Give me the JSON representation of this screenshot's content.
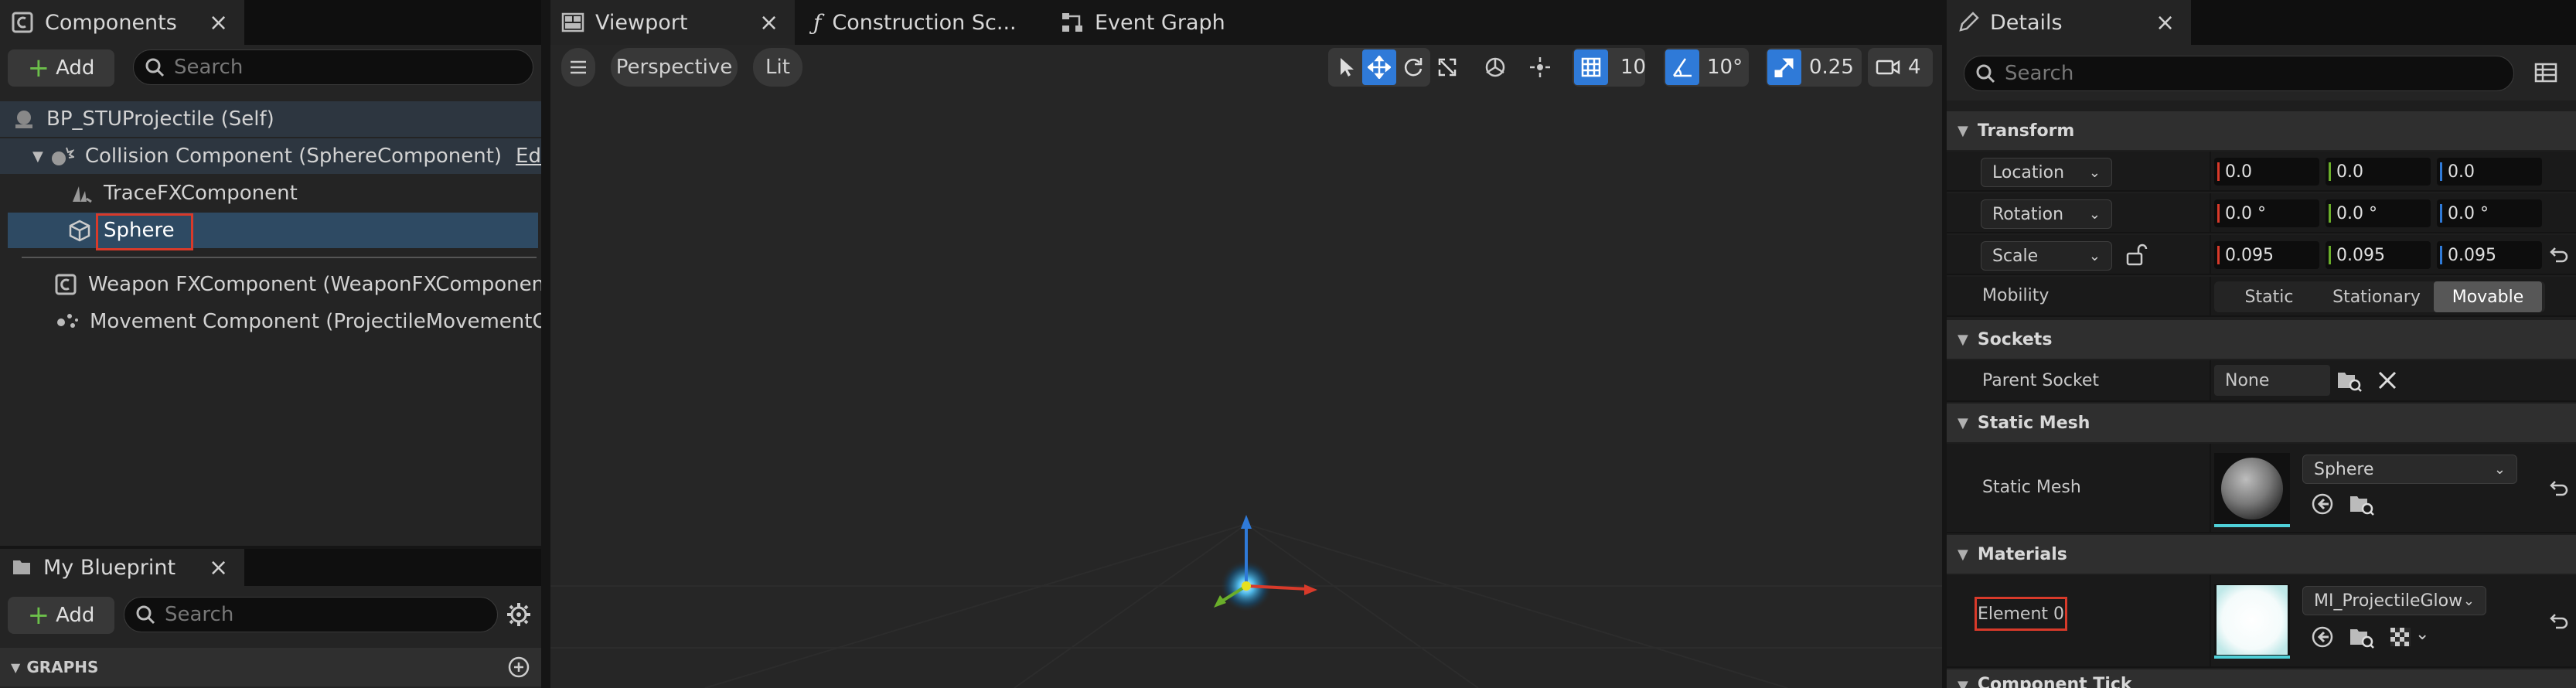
{
  "components": {
    "tab_title": "Components",
    "add_label": "Add",
    "search_placeholder": "Search",
    "tree": {
      "root": "BP_STUProjectile (Self)",
      "collision": "Collision Component (SphereComponent)",
      "collision_edit": "Edit in",
      "trace_fx": "TraceFXComponent",
      "sphere": "Sphere",
      "weapon_fx": "Weapon FXComponent (WeaponFXComponent)",
      "movement": "Movement Component (ProjectileMovementCom"
    }
  },
  "my_blueprint": {
    "tab_title": "My Blueprint",
    "add_label": "Add",
    "search_placeholder": "Search",
    "graphs_label": "GRAPHS"
  },
  "viewport": {
    "tabs": [
      "Viewport",
      "Construction Sc...",
      "Event Graph"
    ],
    "perspective_label": "Perspective",
    "lit_label": "Lit",
    "grid_snap": "10",
    "angle_snap": "10°",
    "scale_snap": "0.25",
    "camera_speed": "4"
  },
  "details": {
    "tab_title": "Details",
    "search_placeholder": "Search",
    "transform": {
      "header": "Transform",
      "location_label": "Location",
      "rotation_label": "Rotation",
      "scale_label": "Scale",
      "location": [
        "0.0",
        "0.0",
        "0.0"
      ],
      "rotation": [
        "0.0 °",
        "0.0 °",
        "0.0 °"
      ],
      "scale": [
        "0.095",
        "0.095",
        "0.095"
      ],
      "mobility_label": "Mobility",
      "mobility_options": [
        "Static",
        "Stationary",
        "Movable"
      ]
    },
    "sockets": {
      "header": "Sockets",
      "parent_socket_label": "Parent Socket",
      "parent_socket_value": "None"
    },
    "static_mesh": {
      "header": "Static Mesh",
      "label": "Static Mesh",
      "value": "Sphere"
    },
    "materials": {
      "header": "Materials",
      "element_label": "Element 0",
      "value": "MI_ProjectileGlow"
    },
    "component_tick": {
      "header": "Component Tick"
    }
  },
  "colors": {
    "accent_blue": "#2f7ad8",
    "selection": "#2e4a63",
    "highlight_red": "#d83a2a",
    "axis_x": "#d83a2a",
    "axis_y": "#6aae2a",
    "axis_z": "#2f7ad8"
  }
}
